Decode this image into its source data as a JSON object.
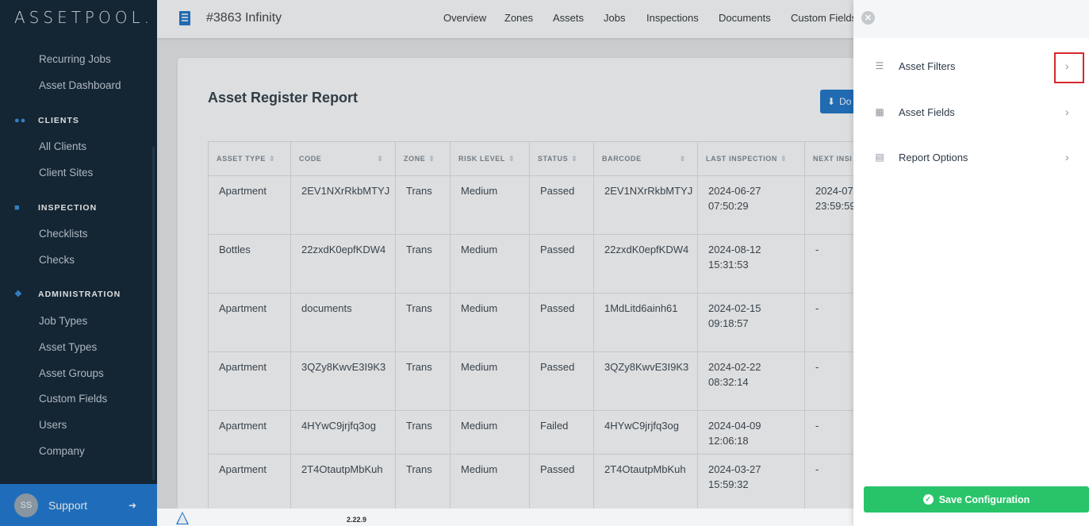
{
  "brand": {
    "logo_text": "ASSETPOOL."
  },
  "sidebar": {
    "top_links": [
      "Recurring Jobs",
      "Asset Dashboard"
    ],
    "sections": [
      {
        "title": "CLIENTS",
        "icon": "users-icon",
        "links": [
          "All Clients",
          "Client Sites"
        ]
      },
      {
        "title": "INSPECTION",
        "icon": "clipboard-icon",
        "links": [
          "Checklists",
          "Checks"
        ]
      },
      {
        "title": "ADMINISTRATION",
        "icon": "admin-icon",
        "links": [
          "Job Types",
          "Asset Types",
          "Asset Groups",
          "Custom Fields",
          "Users",
          "Company"
        ]
      }
    ],
    "support": {
      "avatar": "SS",
      "label": "Support"
    }
  },
  "topbar": {
    "site_title": "#3863 Infinity",
    "nav": [
      "Overview",
      "Zones",
      "Assets",
      "Jobs",
      "Inspections",
      "Documents",
      "Custom Fields"
    ]
  },
  "report": {
    "title": "Asset Register Report",
    "download_label": "Do",
    "columns": [
      "ASSET TYPE",
      "CODE",
      "ZONE",
      "RISK LEVEL",
      "STATUS",
      "BARCODE",
      "LAST INSPECTION",
      "NEXT INSI"
    ],
    "rows": [
      [
        "Apartment",
        "2EV1NXrRkbMTYJ",
        "Trans",
        "Medium",
        "Passed",
        "2EV1NXrRkbMTYJ",
        "2024-06-27",
        "07:50:29",
        "2024-07-",
        "23:59:59"
      ],
      [
        "Bottles",
        "22zxdK0epfKDW4",
        "Trans",
        "Medium",
        "Passed",
        "22zxdK0epfKDW4",
        "2024-08-12",
        "15:31:53",
        "-",
        ""
      ],
      [
        "Apartment",
        "documents",
        "Trans",
        "Medium",
        "Passed",
        "1MdLitd6ainh61",
        "2024-02-15",
        "09:18:57",
        "-",
        ""
      ],
      [
        "Apartment",
        "3QZy8KwvE3I9K3",
        "Trans",
        "Medium",
        "Passed",
        "3QZy8KwvE3I9K3",
        "2024-02-22",
        "08:32:14",
        "-",
        ""
      ],
      [
        "Apartment",
        "4HYwC9jrjfq3og",
        "Trans",
        "Medium",
        "Failed",
        "4HYwC9jrjfq3og",
        "2024-04-09",
        "12:06:18",
        "-",
        ""
      ],
      [
        "Apartment",
        "2T4OtautpMbKuh",
        "Trans",
        "Medium",
        "Passed",
        "2T4OtautpMbKuh",
        "2024-03-27",
        "15:59:32",
        "-",
        ""
      ]
    ]
  },
  "footer": {
    "version": "2.22.9"
  },
  "panel": {
    "items": [
      {
        "label": "Asset Filters",
        "icon": "filter-icon"
      },
      {
        "label": "Asset Fields",
        "icon": "grid-icon"
      },
      {
        "label": "Report Options",
        "icon": "document-icon"
      }
    ],
    "save_label": "Save Configuration"
  },
  "colors": {
    "sidebar_bg": "#0c1e2e",
    "accent_blue": "#1a73c9",
    "save_green": "#29c46a",
    "highlight_red": "#d6282c"
  }
}
